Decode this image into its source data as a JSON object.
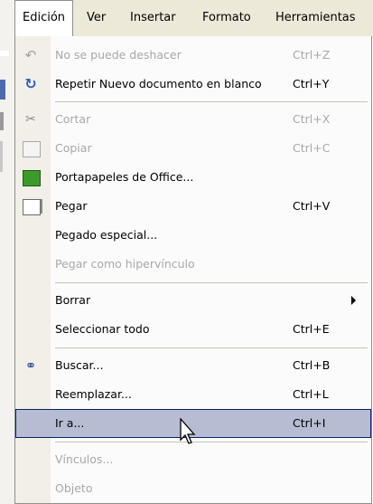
{
  "menubar": {
    "items": [
      {
        "label": "Edición"
      },
      {
        "label": "Ver"
      },
      {
        "label": "Insertar"
      },
      {
        "label": "Formato"
      },
      {
        "label": "Herramientas"
      }
    ]
  },
  "menu": {
    "items": [
      {
        "label": "No se puede deshacer",
        "shortcut": "Ctrl+Z",
        "icon": "undo-icon"
      },
      {
        "label": "Repetir Nuevo documento en blanco",
        "shortcut": "Ctrl+Y",
        "icon": "redo-icon"
      },
      {
        "label": "Cortar",
        "shortcut": "Ctrl+X",
        "icon": "cut-icon"
      },
      {
        "label": "Copiar",
        "shortcut": "Ctrl+C",
        "icon": "copy-icon"
      },
      {
        "label": "Portapapeles de Office...",
        "shortcut": "",
        "icon": "office-clipboard-icon"
      },
      {
        "label": "Pegar",
        "shortcut": "Ctrl+V",
        "icon": "paste-icon"
      },
      {
        "label": "Pegado especial...",
        "shortcut": ""
      },
      {
        "label": "Pegar como hipervínculo",
        "shortcut": ""
      },
      {
        "label": "Borrar",
        "shortcut": ""
      },
      {
        "label": "Seleccionar todo",
        "shortcut": "Ctrl+E"
      },
      {
        "label": "Buscar...",
        "shortcut": "Ctrl+B",
        "icon": "find-icon"
      },
      {
        "label": "Reemplazar...",
        "shortcut": "Ctrl+L"
      },
      {
        "label": "Ir a...",
        "shortcut": "Ctrl+I"
      },
      {
        "label": "Vínculos...",
        "shortcut": ""
      },
      {
        "label": "Objeto",
        "shortcut": ""
      }
    ]
  }
}
